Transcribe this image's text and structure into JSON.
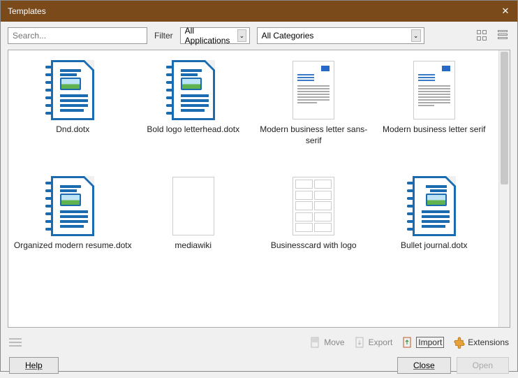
{
  "window": {
    "title": "Templates"
  },
  "toolbar": {
    "search_placeholder": "Search...",
    "filter_label": "Filter",
    "applications": "All Applications",
    "categories": "All Categories"
  },
  "templates": [
    {
      "label": "Dnd.dotx"
    },
    {
      "label": "Bold logo letterhead.dotx"
    },
    {
      "label": "Modern business letter sans-serif"
    },
    {
      "label": "Modern business letter serif"
    },
    {
      "label": "Organized modern resume.dotx"
    },
    {
      "label": "mediawiki"
    },
    {
      "label": "Businesscard with logo"
    },
    {
      "label": "Bullet journal.dotx"
    }
  ],
  "footer": {
    "move": "Move",
    "export": "Export",
    "import": "Import",
    "extensions": "Extensions",
    "help": "Help",
    "close": "Close",
    "open": "Open"
  }
}
